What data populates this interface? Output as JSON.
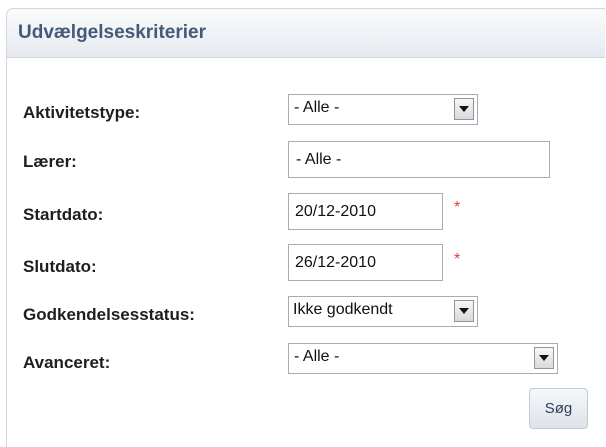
{
  "panel": {
    "title": "Udvælgelseskriterier"
  },
  "form": {
    "activity_type": {
      "label": "Aktivitetstype:",
      "value": "- Alle -"
    },
    "teacher": {
      "label": "Lærer:",
      "value": "- Alle -"
    },
    "start_date": {
      "label": "Startdato:",
      "value": "20/12-2010",
      "required_mark": "*"
    },
    "end_date": {
      "label": "Slutdato:",
      "value": "26/12-2010",
      "required_mark": "*"
    },
    "approval_status": {
      "label": "Godkendelsesstatus:",
      "value": "Ikke godkendt"
    },
    "advanced": {
      "label": "Avanceret:",
      "value": "- Alle -"
    },
    "search_button": "Søg"
  },
  "colors": {
    "header_text": "#435b78",
    "required": "#e53b3b"
  }
}
